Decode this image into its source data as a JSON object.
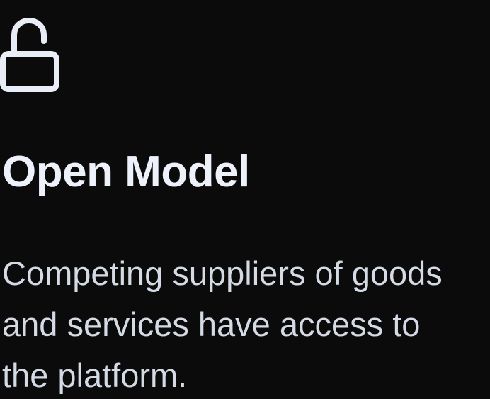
{
  "feature": {
    "icon": "unlock-icon",
    "title": "Open Model",
    "description": "Competing suppliers of goods and services have access to the platform."
  },
  "colors": {
    "background": "#0b0b0c",
    "title": "#edf2fa",
    "text": "#d5dbe4",
    "icon": "#e9eef6"
  }
}
